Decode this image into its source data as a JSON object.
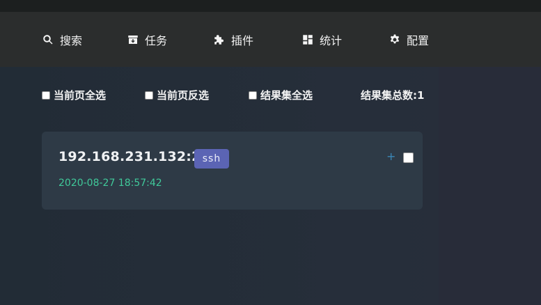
{
  "nav": {
    "items": [
      {
        "label": "搜索",
        "icon": "search-icon"
      },
      {
        "label": "任务",
        "icon": "archive-down-icon"
      },
      {
        "label": "插件",
        "icon": "puzzle-icon"
      },
      {
        "label": "统计",
        "icon": "dashboard-icon"
      },
      {
        "label": "配置",
        "icon": "gear-icon"
      }
    ]
  },
  "filters": {
    "select_page": "当前页全选",
    "invert_page": "当前页反选",
    "select_all_results": "结果集全选",
    "total_label": "结果集总数:1"
  },
  "results": [
    {
      "host": "192.168.231.132:22",
      "protocol": "ssh",
      "timestamp": "2020-08-27 18:57:42",
      "expand": "+"
    }
  ],
  "colors": {
    "navbar": "#2b2d2d",
    "card": "#2e3a46",
    "badge": "#5b64b4",
    "timestamp": "#40c99a",
    "plus": "#3b88b8"
  }
}
